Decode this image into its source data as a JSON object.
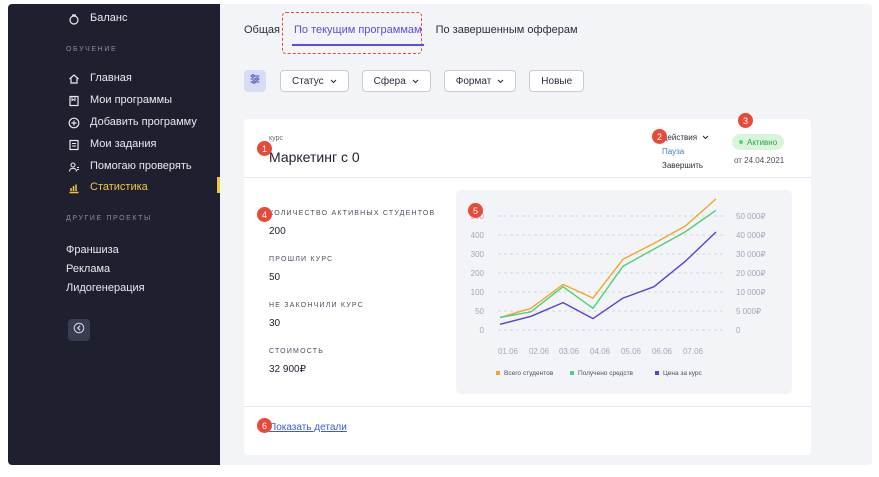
{
  "sidebar": {
    "balance_label": "Баланс",
    "section_learning": "ОБУЧЕНИЕ",
    "items": [
      {
        "label": "Главная",
        "icon": "home-icon"
      },
      {
        "label": "Мои программы",
        "icon": "bookmark-icon"
      },
      {
        "label": "Добавить программу",
        "icon": "plus-circle-icon"
      },
      {
        "label": "Мои задания",
        "icon": "tasks-icon"
      },
      {
        "label": "Помогаю проверять",
        "icon": "users-icon"
      },
      {
        "label": "Статистика",
        "icon": "stats-icon"
      }
    ],
    "section_other": "ДРУГИЕ ПРОЕКТЫ",
    "projects": [
      "Франшиза",
      "Реклама",
      "Лидогенерация"
    ]
  },
  "tabs": [
    "Общая",
    "По текущим программам",
    "По завершенным офферам"
  ],
  "active_tab": "По текущим программам",
  "filters": {
    "status": "Статус",
    "sphere": "Сфера",
    "format": "Формат",
    "new": "Новые"
  },
  "course": {
    "kicker": "курс",
    "title": "Маркетинг с 0",
    "actions_label": "Действия",
    "action_pause": "Пауза",
    "action_finish": "Завершить",
    "status": "Активно",
    "status_date": "от 24.04.2021"
  },
  "stats": [
    {
      "label": "КОЛИЧЕСТВО АКТИВНЫХ СТУДЕНТОВ",
      "value": "200"
    },
    {
      "label": "ПРОШЛИ КУРС",
      "value": "50"
    },
    {
      "label": "НЕ ЗАКОНЧИЛИ КУРС",
      "value": "30"
    },
    {
      "label": "СТОИМОСТЬ",
      "value": "32 900₽"
    }
  ],
  "show_details": "Показать детали",
  "markers": [
    "1",
    "2",
    "3",
    "4",
    "5",
    "6"
  ],
  "colors": {
    "accent": "#5b4dde",
    "active": "#f5c542",
    "marker": "#e84a3a",
    "series_students": "#f5a623",
    "series_revenue": "#4cd07d",
    "series_price": "#5b3fd6"
  },
  "chart_data": {
    "type": "line",
    "categories": [
      "01.06",
      "02.06",
      "03.06",
      "04.06",
      "05.06",
      "06.06",
      "07.06"
    ],
    "y_left_ticks": [
      "500",
      "400",
      "300",
      "200",
      "100",
      "50",
      "0"
    ],
    "y_right_ticks": [
      "50 000₽",
      "40 000₽",
      "30 000₽",
      "20 000₽",
      "10 000₽",
      "5 000₽",
      "0"
    ],
    "series": [
      {
        "name": "Всего студентов",
        "values": [
          55,
          95,
          200,
          140,
          310,
          380,
          455,
          575
        ]
      },
      {
        "name": "Получено средств",
        "values": [
          55,
          80,
          190,
          95,
          280,
          355,
          430,
          525
        ]
      },
      {
        "name": "Цена за курс",
        "values": [
          25,
          60,
          120,
          50,
          140,
          190,
          300,
          430
        ]
      }
    ],
    "x_points": [
      "01.06",
      "01.06-02.06",
      "02.06-03.06",
      "03.06-04.06",
      "04.06-05.06",
      "05.06-06.06",
      "06.06-07.06",
      "07.06"
    ]
  }
}
